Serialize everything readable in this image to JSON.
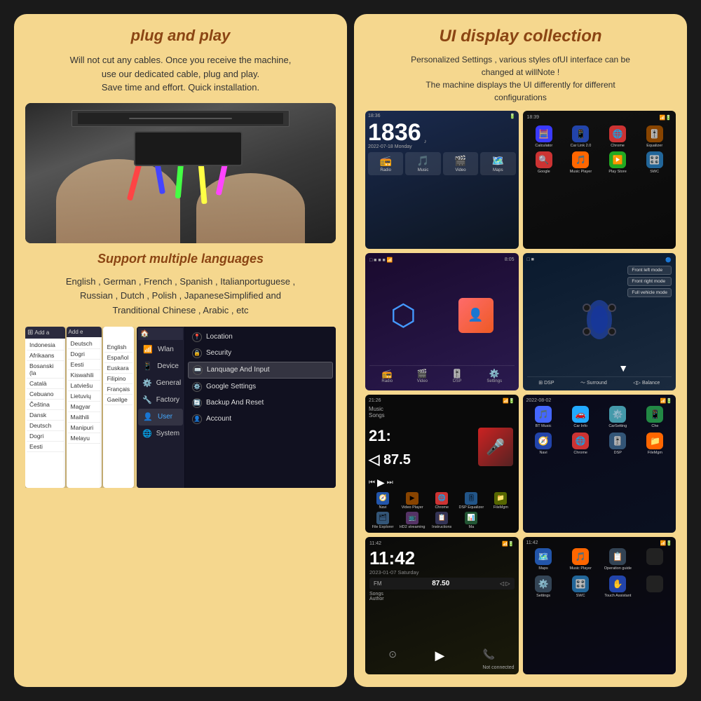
{
  "left": {
    "plug_title": "plug and play",
    "plug_desc": "Will not cut any cables. Once you receive the machine,\nuse our dedicated cable, plug and play.\nSave time and effort. Quick installation.",
    "lang_title": "Support multiple languages",
    "lang_desc": "English , German , French , Spanish , Italianportuguese ,\nRussian , Dutch , Polish , JapaneseSimplified and\nTranditional Chinese , Arabic , etc",
    "lang_list": [
      "Indonesia",
      "Afrikaans",
      "Bosanski (la",
      "Català",
      "Cebuano",
      "Čeština",
      "Dansk",
      "Deutsch",
      "Dogri",
      "Eesti"
    ],
    "lang_list2": [
      "Deutsch",
      "Dogri",
      "Eesti",
      "Kiswahili",
      "Latviešu",
      "Lietuvių",
      "Magyar",
      "Maithili",
      "Manipuri",
      "Melayu"
    ],
    "lang_list3": [
      "English",
      "Español",
      "Euskara",
      "Filipino",
      "Français",
      "Gaeilge"
    ],
    "settings_nav": [
      {
        "icon": "📶",
        "label": "Wlan"
      },
      {
        "icon": "📱",
        "label": "Device"
      },
      {
        "icon": "⚙️",
        "label": "General"
      },
      {
        "icon": "🔧",
        "label": "Factory"
      },
      {
        "icon": "👤",
        "label": "User",
        "active": true
      },
      {
        "icon": "🌐",
        "label": "System"
      }
    ],
    "settings_items": [
      {
        "icon": "📍",
        "label": "Location"
      },
      {
        "icon": "🔒",
        "label": "Security"
      },
      {
        "icon": "⌨️",
        "label": "Lanquage And Input",
        "highlighted": true
      },
      {
        "icon": "⚙️",
        "label": "Google Settings"
      },
      {
        "icon": "🔄",
        "label": "Backup And Reset"
      },
      {
        "icon": "👤",
        "label": "Account"
      }
    ]
  },
  "right": {
    "title": "UI display collection",
    "subtitle": "Personalized Settings , various styles ofUI interface can be\nchanged at willNote !\nThe machine displays the UI differently for different\nconfigurations",
    "screens": [
      {
        "id": "clock-music",
        "time": "18",
        "time2": "36",
        "date": "2022-07-18 Monday",
        "icons": [
          {
            "sym": "📻",
            "label": "Radio"
          },
          {
            "sym": "🎵",
            "label": "Music"
          },
          {
            "sym": "🎬",
            "label": "Video"
          },
          {
            "sym": "🗺️",
            "label": "Maps"
          }
        ]
      },
      {
        "id": "app-grid",
        "time": "18:39",
        "apps_row1": [
          {
            "sym": "🧮",
            "label": "Calculator",
            "color": "#3a3aff"
          },
          {
            "sym": "📱",
            "label": "Car Link 2.0",
            "color": "#2244aa"
          },
          {
            "sym": "🌐",
            "label": "Chrome",
            "color": "#cc3333"
          },
          {
            "sym": "🎚️",
            "label": "Equalizer",
            "color": "#884400"
          }
        ],
        "apps_row2": [
          {
            "sym": "🔍",
            "label": "Google",
            "color": "#cc3333"
          },
          {
            "sym": "🎵",
            "label": "Music Player",
            "color": "#ff6600"
          },
          {
            "sym": "▶️",
            "label": "Play Store",
            "color": "#22aa22"
          },
          {
            "sym": "🎛️",
            "label": "SWC",
            "color": "#226699"
          }
        ]
      },
      {
        "id": "bluetooth",
        "time": "8:05",
        "bottom": [
          "Radio",
          "Video",
          "DSP",
          "Settings"
        ]
      },
      {
        "id": "dsp-surround",
        "modes": [
          "Front left mode",
          "Front right mode",
          "Full vehicle mode"
        ],
        "bottom": [
          "DSP",
          "Surround",
          "Balance"
        ]
      },
      {
        "id": "music-player",
        "time": "21:",
        "freq": "87.5",
        "bottom": [
          "Navi",
          "Video Player",
          "Chrome",
          "DSP Equalizer",
          "FileMgm",
          "File Explorer",
          "HD2 streaming",
          "Instructions",
          "Ma"
        ]
      },
      {
        "id": "app-grid-2",
        "time": "2022-08-02",
        "apps": [
          {
            "sym": "🎵",
            "label": "BT Music",
            "color": "#4466ff"
          },
          {
            "sym": "🚗",
            "label": "Car Info",
            "color": "#22aaff"
          },
          {
            "sym": "⚙️",
            "label": "CarSetting",
            "color": "#4499aa"
          },
          {
            "sym": "📱",
            "label": "Che",
            "color": "#228844"
          }
        ]
      },
      {
        "id": "clock-dark",
        "time": "11:42",
        "date": "2023-01-07 Saturday",
        "bottom": [
          "Navi",
          "Maps",
          "Music Player",
          "Operation guide"
        ]
      },
      {
        "id": "app-grid-3",
        "time": "11:42",
        "apps": [
          {
            "sym": "⚙️",
            "label": "Settings",
            "color": "#334455"
          },
          {
            "sym": "🎛️",
            "label": "SWC",
            "color": "#226699"
          },
          {
            "sym": "🚗",
            "label": "Touch Assist",
            "color": "#2244aa"
          }
        ]
      }
    ]
  }
}
